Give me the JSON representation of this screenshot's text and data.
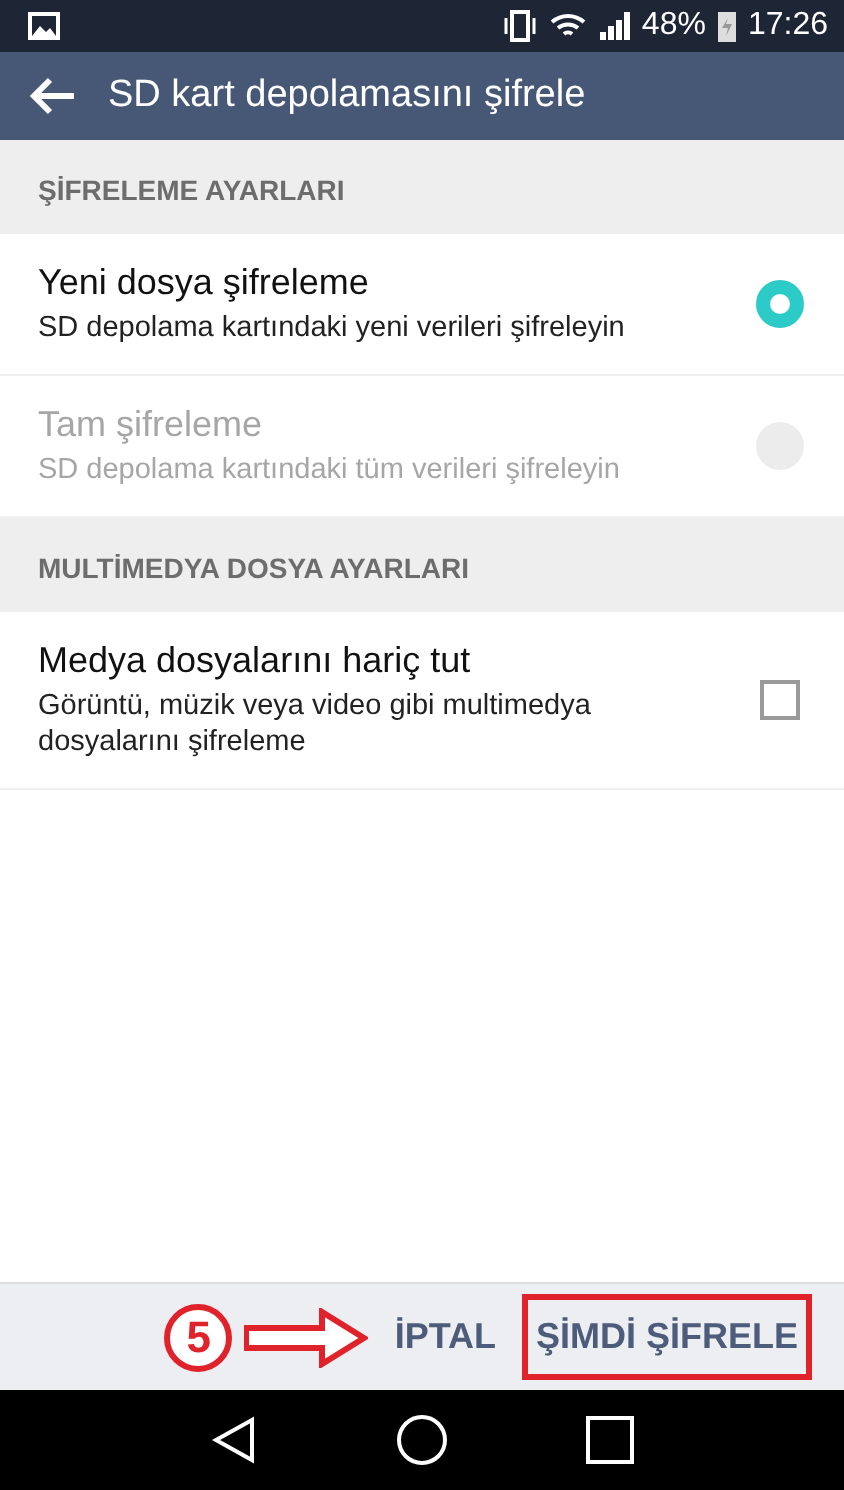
{
  "status_bar": {
    "battery": "48%",
    "time": "17:26"
  },
  "app_bar": {
    "title": "SD kart depolamasını şifrele"
  },
  "sections": [
    {
      "header": "ŞİFRELEME AYARLARI",
      "items": [
        {
          "kind": "radio",
          "title": "Yeni dosya şifreleme",
          "subtitle": "SD depolama kartındaki yeni verileri şifreleyin",
          "selected": true,
          "disabled": false
        },
        {
          "kind": "radio",
          "title": "Tam şifreleme",
          "subtitle": "SD depolama kartındaki tüm verileri şifreleyin",
          "selected": false,
          "disabled": true
        }
      ]
    },
    {
      "header": "MULTİMEDYA DOSYA AYARLARI",
      "items": [
        {
          "kind": "checkbox",
          "title": "Medya dosyalarını hariç tut",
          "subtitle": "Görüntü, müzik veya video gibi multimedya dosyalarını şifreleme",
          "checked": false,
          "disabled": false
        }
      ]
    }
  ],
  "bottom_buttons": [
    {
      "label": "İPTAL",
      "highlighted": false
    },
    {
      "label": "ŞİMDİ ŞİFRELE",
      "highlighted": true
    }
  ],
  "annotation": {
    "step": "5"
  }
}
